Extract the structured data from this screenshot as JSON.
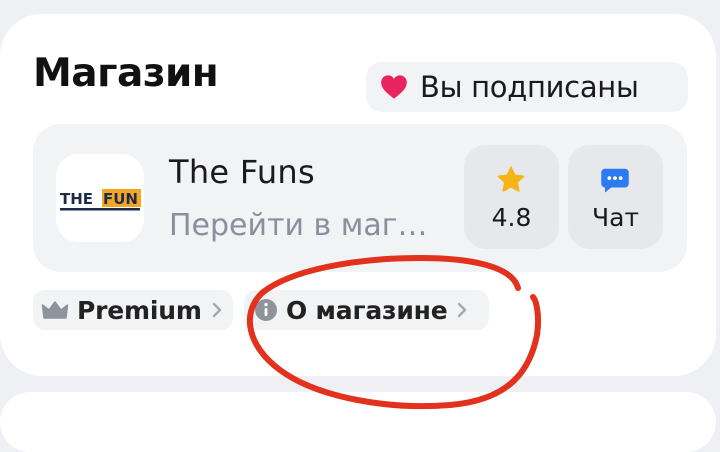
{
  "shop": {
    "title": "Магазин",
    "subscribed_label": "Вы подписаны",
    "store": {
      "name": "The Funs",
      "link_text": "Перейти в магазин",
      "logo_text_dark": "THE",
      "logo_text_accent": "FUN",
      "rating_value": "4.8",
      "chat_label": "Чат"
    },
    "chips": {
      "premium_label": "Premium",
      "about_label": "О магазине"
    }
  },
  "colors": {
    "heart": "#e8245f",
    "star": "#f5b417",
    "chat_bubble": "#2d7bf0",
    "logo_dark": "#1d2a4a",
    "logo_accent": "#f5a623",
    "annotation": "#e2311d"
  },
  "icons": {
    "heart": "heart-icon",
    "star": "star-icon",
    "chat": "chat-bubble-icon",
    "crown": "crown-icon",
    "info": "info-icon",
    "chevron": "chevron-right-icon"
  }
}
